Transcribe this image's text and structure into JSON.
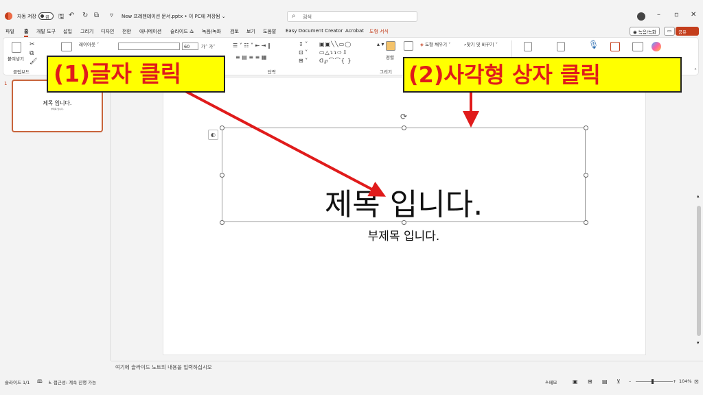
{
  "titlebar": {
    "autosave_label": "자동 저장",
    "autosave_state": "끔",
    "file_name": "New 프레젠테이션 문서.pptx • 이 PC에 저장됨 ⌄",
    "search_placeholder": "검색"
  },
  "menu": {
    "items": [
      "파일",
      "홈",
      "개발 도구",
      "삽입",
      "그리기",
      "디자인",
      "전환",
      "애니메이션",
      "슬라이드 쇼",
      "녹음/녹화",
      "검토",
      "보기",
      "도움말",
      "Easy Document Creator",
      "Acrobat",
      "도형 서식"
    ],
    "record_button": "◉ 녹음/녹화",
    "share_button": "공유"
  },
  "ribbon": {
    "paste": "붙여넣기",
    "layout": "레이아웃 ˅",
    "font_size": "60",
    "arrange": "정렬",
    "shape_fill": "도형 채우기 ˅",
    "find_replace": "찾기 및 바꾸기 ˅",
    "groups": {
      "clipboard": "클립보드",
      "paragraph": "단락",
      "drawing": "그리기"
    }
  },
  "annotations": {
    "callout1": "(1)글자 클릭",
    "callout2": "(2)사각형 상자 클릭",
    "arrow_color": "#e01b1b"
  },
  "slide_panel": {
    "slide_number": "1",
    "thumb_title": "제목 입니다.",
    "thumb_subtitle": "부제목 입니다."
  },
  "slide": {
    "title": "제목 입니다.",
    "subtitle": "부제목 입니다."
  },
  "notes": {
    "placeholder": "여기에 슬라이드 노트의 내용을 입력하십시오"
  },
  "statusbar": {
    "slide_info": "슬라이드 1/1",
    "accessibility": "접근성: 계속 진행 가능",
    "notes_label": "메모",
    "zoom_level": "104%"
  },
  "colors": {
    "accent": "#c43e1c",
    "callout_bg": "#ffff00"
  }
}
